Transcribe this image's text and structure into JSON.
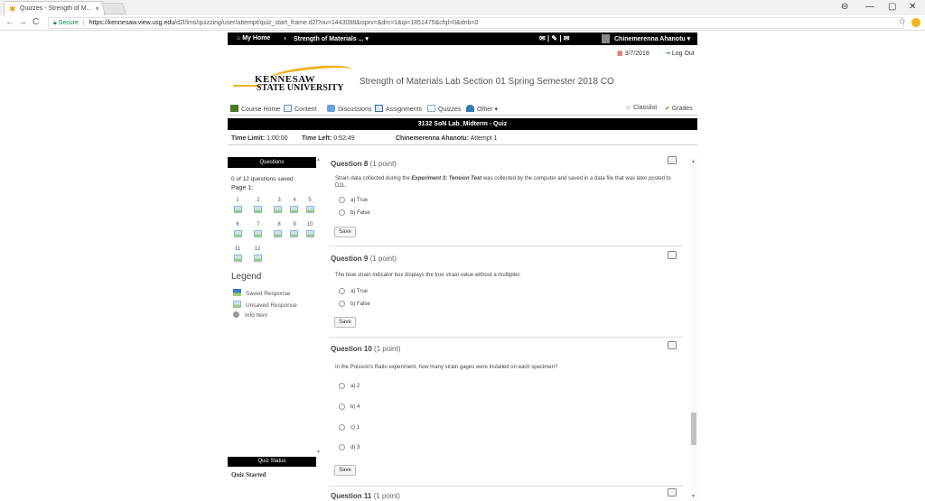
{
  "browser": {
    "tab_title": "Quizzes - Strength of M...",
    "tab_close": "×",
    "security_label": "Secure",
    "url_host": "https://kennesaw.view.usg.edu",
    "url_path": "/d2l/lms/quizzing/user/attempt/quiz_start_frame.d2l?ou=1443088&isprv=&drc=1&qi=1851475&cfql=0&dnb=0",
    "back": "←",
    "forward": "→",
    "reload": "C",
    "star": "☆",
    "win_account": "⊖",
    "win_min": "—",
    "win_max": "▢",
    "win_close": "✕"
  },
  "navbar": {
    "home": "My Home",
    "crumb_sep": "›",
    "course": "Strength of Materials ...",
    "icons": "✉ | ✎ | ✉",
    "user": "Chinemerenna Ahanotu"
  },
  "header": {
    "date": "3/7/2018",
    "logout": "Log Out",
    "logo_line1": "KENNESAW",
    "logo_line2": "STATE UNIVERSITY",
    "course_title": "Strength of Materials Lab Section 01 Spring Semester 2018 CO"
  },
  "course_menu": {
    "items": [
      "Course Home",
      "Content",
      "Discussions",
      "Assignments",
      "Quizzes",
      "Other"
    ],
    "classlist": "Classlist",
    "grades": "Grades"
  },
  "quiz": {
    "title": "3132 SoN Lab_Midterm - Quiz",
    "time_limit_label": "Time Limit:",
    "time_limit": "1:00:00",
    "time_left_label": "Time Left:",
    "time_left": "0:52:49",
    "attempt_label": "Chinemerenna Ahanotu:",
    "attempt": "Attempt 1"
  },
  "sidebar": {
    "questions_header": "Questions",
    "saved_count": "0 of 12 questions saved",
    "page_label": "Page 1:",
    "numbers_row1": [
      "1",
      "2",
      "3",
      "4",
      "5"
    ],
    "numbers_row2": [
      "6",
      "7",
      "8",
      "9",
      "10"
    ],
    "numbers_row3": [
      "11",
      "12"
    ],
    "legend_title": "Legend",
    "legend_saved": "Saved Response",
    "legend_unsaved": "Unsaved Response",
    "legend_info": "Info Item",
    "status_header": "Quiz Status",
    "status_text": "Quiz Started"
  },
  "questions": [
    {
      "title": "Question 8",
      "points": "(1 point)",
      "text_prefix": "Strain data collected during the ",
      "text_emph": "Experiment 3: Tension Test",
      "text_suffix": " was collected by the computer and saved in a data file that was later posted to D2L.",
      "options": [
        "a) True",
        "b) False"
      ],
      "save": "Save"
    },
    {
      "title": "Question 9",
      "points": "(1 point)",
      "text": "The blue strain indicator box displays the true strain value without a multiplier.",
      "options": [
        "a) True",
        "b) False"
      ],
      "save": "Save"
    },
    {
      "title": "Question 10",
      "points": "(1 point)",
      "text": "In the Poisson's Ratio experiment, how many strain gages were installed on each specimen?",
      "options": [
        "a) 2",
        "b) 4",
        "c) 1",
        "d) 3"
      ],
      "save": "Save"
    },
    {
      "title": "Question 11",
      "points": "(1 point)"
    }
  ]
}
